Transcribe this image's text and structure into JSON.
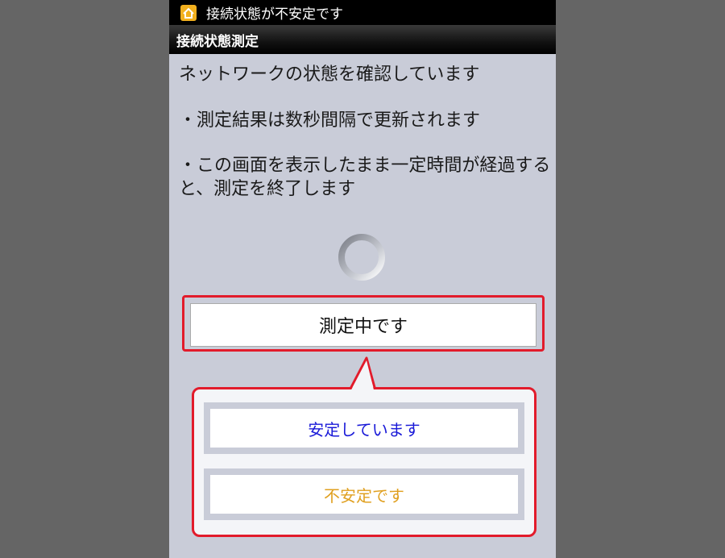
{
  "statusbar": {
    "icon": "app-icon",
    "text": "接続状態が不安定です"
  },
  "header": {
    "title": "接続状態測定"
  },
  "message": {
    "line1": "ネットワークの状態を確認しています",
    "line2": "・測定結果は数秒間隔で更新されます",
    "line3": "・この画面を表示したまま一定時間が経過すると、測定を終了します"
  },
  "spinner": {
    "icon": "loading-spinner-icon"
  },
  "status_button": {
    "label": "測定中です"
  },
  "legend": {
    "stable_label": "安定しています",
    "unstable_label": "不安定です"
  },
  "colors": {
    "highlight": "#e21b2b",
    "stable": "#1a1ad8",
    "unstable": "#e0a020",
    "screen_bg": "#c9ccd8",
    "outer_bg": "#656565"
  }
}
